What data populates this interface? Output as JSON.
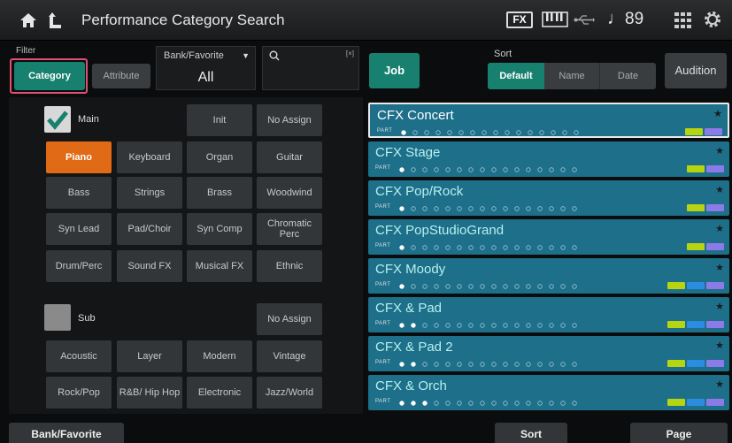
{
  "header": {
    "title": "Performance Category Search",
    "fx_label": "FX",
    "tempo": "89"
  },
  "filter": {
    "label": "Filter",
    "tabs": [
      {
        "label": "Category",
        "selected": true
      },
      {
        "label": "Attribute",
        "selected": false
      }
    ],
    "bank_favorite": {
      "label": "Bank/Favorite",
      "value": "All"
    },
    "search": {
      "value": "",
      "clear_icon": "clear-text-icon"
    }
  },
  "job_label": "Job",
  "sort": {
    "label": "Sort",
    "options": [
      {
        "label": "Default",
        "selected": true
      },
      {
        "label": "Name",
        "selected": false
      },
      {
        "label": "Date",
        "selected": false
      }
    ]
  },
  "audition_label": "Audition",
  "main_category": {
    "label": "Main",
    "checked": true,
    "buttons": [
      "Init",
      "No Assign",
      "Piano",
      "Keyboard",
      "Organ",
      "Guitar",
      "Bass",
      "Strings",
      "Brass",
      "Woodwind",
      "Syn Lead",
      "Pad/Choir",
      "Syn Comp",
      "Chromatic Perc",
      "Drum/Perc",
      "Sound FX",
      "Musical FX",
      "Ethnic"
    ],
    "selected": "Piano"
  },
  "sub_category": {
    "label": "Sub",
    "checked": false,
    "buttons": [
      "No Assign",
      "Acoustic",
      "Layer",
      "Modern",
      "Vintage",
      "Rock/Pop",
      "R&B/ Hip Hop",
      "Electronic",
      "Jazz/World"
    ]
  },
  "results": [
    {
      "name": "CFX Concert",
      "parts": 1,
      "selected": true,
      "badges": [
        "green",
        "purple"
      ]
    },
    {
      "name": "CFX Stage",
      "parts": 1,
      "selected": false,
      "badges": [
        "green",
        "purple"
      ]
    },
    {
      "name": "CFX Pop/Rock",
      "parts": 1,
      "selected": false,
      "badges": [
        "green",
        "purple"
      ]
    },
    {
      "name": "CFX PopStudioGrand",
      "parts": 1,
      "selected": false,
      "badges": [
        "green",
        "purple"
      ]
    },
    {
      "name": "CFX Moody",
      "parts": 1,
      "selected": false,
      "badges": [
        "green",
        "blue",
        "purple"
      ]
    },
    {
      "name": "CFX & Pad",
      "parts": 2,
      "selected": false,
      "badges": [
        "green",
        "blue",
        "purple"
      ]
    },
    {
      "name": "CFX & Pad 2",
      "parts": 2,
      "selected": false,
      "badges": [
        "green",
        "blue",
        "purple"
      ]
    },
    {
      "name": "CFX & Orch",
      "parts": 3,
      "selected": false,
      "badges": [
        "green",
        "blue",
        "purple"
      ]
    }
  ],
  "part_label": "PART",
  "bottom": {
    "bank_favorite": "Bank/Favorite",
    "sort": "Sort",
    "page": "Page"
  },
  "colors": {
    "accent_green": "#18806e",
    "selected_orange": "#e06a16",
    "result_blue": "#1d6f8a"
  }
}
